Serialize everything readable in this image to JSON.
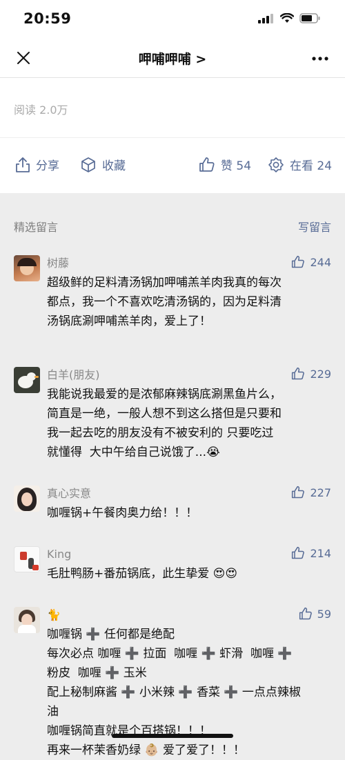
{
  "status_bar": {
    "time": "20:59"
  },
  "nav": {
    "title": "呷哺呷哺 >"
  },
  "article": {
    "read_count": "阅读 2.0万"
  },
  "actions": {
    "share": "分享",
    "favorite": "收藏",
    "like": "赞 54",
    "watching": "在看 24"
  },
  "comments_section": {
    "title": "精选留言",
    "write": "写留言"
  },
  "comments": [
    {
      "name": "树藤",
      "likes": "244",
      "text": "超级鲜的足料清汤锅加呷哺羔羊肉我真的每次\n都点，我一个不喜欢吃清汤锅的，因为足料清\n汤锅底涮呷哺羔羊肉，爱上了！"
    },
    {
      "name": "白羊(朋友)",
      "likes": "229",
      "text": "我能说我最爱的是浓郁麻辣锅底涮黑鱼片么，\n简直是一绝，一般人想不到这么搭但是只要和\n我一起去吃的朋友没有不被安利的 只要吃过\n就懂得  大中午给自己说饿了...",
      "emoji_after": "😭"
    },
    {
      "name": "真心实意",
      "likes": "227",
      "text": "咖喱锅+午餐肉奥力给！！！"
    },
    {
      "name": "King",
      "likes": "214",
      "text": "毛肚鸭肠+番茄锅底，此生挚爱 ",
      "emoji_after": "😍😍"
    },
    {
      "name": "🐈",
      "likes": "59",
      "text": "咖喱锅 ➕ 任何都是绝配\n每次必点 咖喱 ➕ 拉面  咖喱 ➕ 虾滑  咖喱 ➕\n粉皮  咖喱 ➕ 玉米\n配上秘制麻酱 ➕ 小米辣 ➕ 香菜 ➕ 一点点辣椒\n油\n咖喱锅简直就是个百搭锅！！！\n再来一杯茉香奶绿 👶🏼 爱了爱了！！！"
    }
  ],
  "colors": {
    "link": "#576b95",
    "background": "#ededed"
  }
}
